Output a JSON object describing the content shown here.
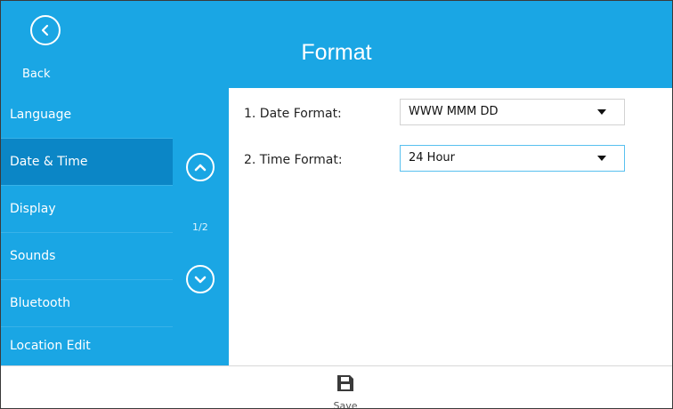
{
  "header": {
    "title": "Format",
    "back_label": "Back",
    "back_icon": "chevron-left-icon"
  },
  "sidebar": {
    "items": [
      {
        "label": "Language",
        "active": false
      },
      {
        "label": "Date & Time",
        "active": true
      },
      {
        "label": "Display",
        "active": false
      },
      {
        "label": "Sounds",
        "active": false
      },
      {
        "label": "Bluetooth",
        "active": false
      },
      {
        "label": "Location Edit",
        "active": false
      }
    ],
    "page_indicator": "1/2",
    "scroll_up_icon": "chevron-up-icon",
    "scroll_down_icon": "chevron-down-icon"
  },
  "content": {
    "rows": [
      {
        "label": "1. Date Format:",
        "value": "WWW MMM DD"
      },
      {
        "label": "2. Time Format:",
        "value": "24 Hour"
      }
    ]
  },
  "footer": {
    "save_label": "Save",
    "save_icon": "floppy-disk-icon"
  },
  "colors": {
    "accent": "#1aa6e4",
    "active_item": "#0b86c6",
    "focus_border": "#58c0ef"
  }
}
